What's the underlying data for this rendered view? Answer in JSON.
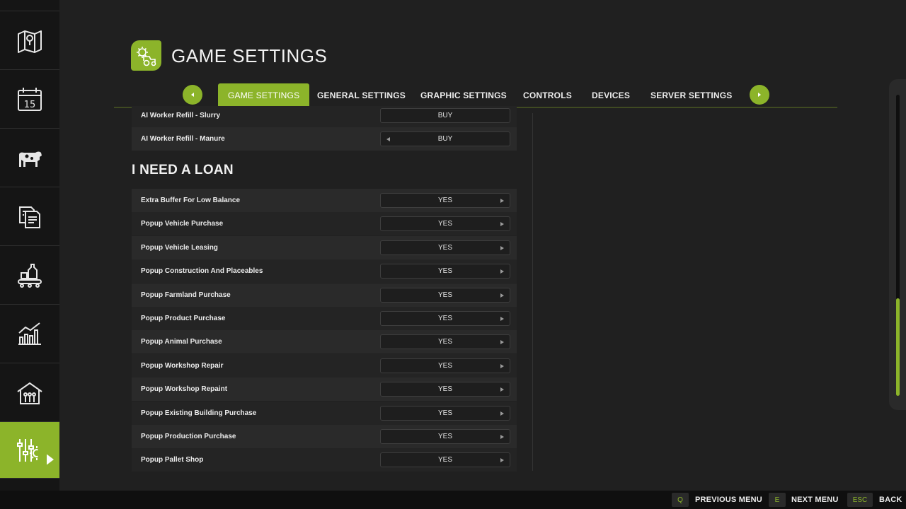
{
  "header": {
    "title": "GAME SETTINGS"
  },
  "tabs": [
    {
      "label": "GAME SETTINGS",
      "active": true
    },
    {
      "label": "GENERAL SETTINGS"
    },
    {
      "label": "GRAPHIC SETTINGS"
    },
    {
      "label": "CONTROLS"
    },
    {
      "label": "DEVICES"
    },
    {
      "label": "SERVER SETTINGS"
    }
  ],
  "sidebar": {
    "items": [
      {
        "icon": "map-icon"
      },
      {
        "icon": "calendar-icon",
        "label": "15"
      },
      {
        "icon": "animals-icon"
      },
      {
        "icon": "contracts-icon"
      },
      {
        "icon": "production-icon"
      },
      {
        "icon": "statistics-icon"
      },
      {
        "icon": "barn-icon"
      },
      {
        "icon": "settings-icon",
        "active": true
      }
    ]
  },
  "settings": {
    "partial_row": {
      "label": "AI Worker Refill - Slurry",
      "value": "BUY"
    },
    "first_row": {
      "label": "AI Worker Refill - Manure",
      "value": "BUY"
    },
    "section_title": "I NEED A LOAN",
    "rows": [
      {
        "label": "Extra Buffer For Low Balance",
        "value": "YES"
      },
      {
        "label": "Popup Vehicle Purchase",
        "value": "YES"
      },
      {
        "label": "Popup Vehicle Leasing",
        "value": "YES"
      },
      {
        "label": "Popup Construction And Placeables",
        "value": "YES"
      },
      {
        "label": "Popup Farmland Purchase",
        "value": "YES"
      },
      {
        "label": "Popup Product Purchase",
        "value": "YES"
      },
      {
        "label": "Popup Animal Purchase",
        "value": "YES"
      },
      {
        "label": "Popup Workshop Repair",
        "value": "YES"
      },
      {
        "label": "Popup Workshop Repaint",
        "value": "YES"
      },
      {
        "label": "Popup Existing Building Purchase",
        "value": "YES"
      },
      {
        "label": "Popup Production Purchase",
        "value": "YES"
      },
      {
        "label": "Popup Pallet Shop",
        "value": "YES"
      }
    ]
  },
  "footer": {
    "prev_key": "Q",
    "prev_label": "PREVIOUS MENU",
    "next_key": "E",
    "next_label": "NEXT MENU",
    "back_key": "ESC",
    "back_label": "BACK"
  },
  "colors": {
    "accent": "#8cb42a",
    "background": "#202020",
    "sidebar": "#151515"
  }
}
